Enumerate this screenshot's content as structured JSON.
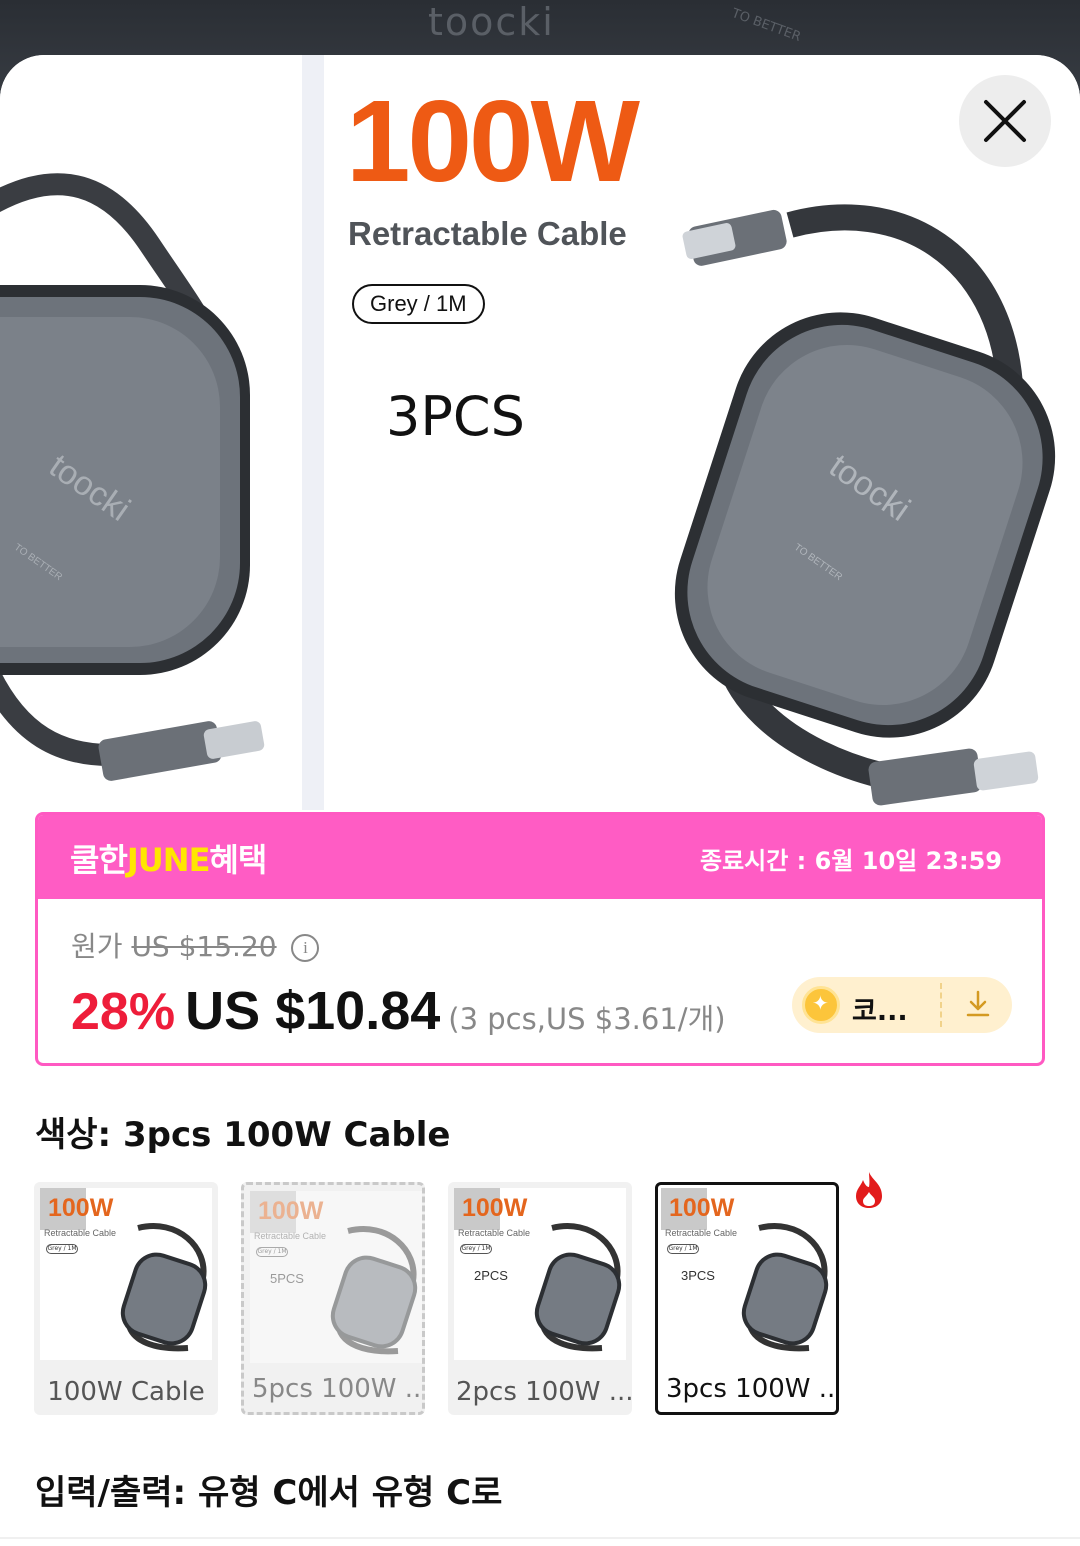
{
  "backdrop": {
    "brand": "toocki",
    "tag": "TO BETTER"
  },
  "hero": {
    "headline": "100W",
    "subline": "Retractable Cable",
    "variant_pill": "Grey / 1M",
    "pcs_label": "3PCS",
    "device_brand": "toocki",
    "device_tag": "TO BETTER"
  },
  "close": {
    "icon": "close-icon"
  },
  "promo": {
    "title_pre": "쿨한",
    "title_highlight": "JUNE",
    "title_post": "혜택",
    "end_time": "종료시간 :  6월 10일 23:59",
    "original_label": "원가",
    "original_price": "US $15.20",
    "discount": "28%",
    "price": "US $10.84",
    "unit_price": "(3 pcs,US $3.61/개)",
    "coupon_label": "코...",
    "colors": {
      "pink": "#ff5cc4",
      "highlight": "#ffe600",
      "discount": "#ee1d3a"
    }
  },
  "color_section": {
    "label": "색상: 3pcs 100W Cable",
    "options": [
      {
        "label": "100W Cable",
        "pcs": "",
        "state": "normal"
      },
      {
        "label": "5pcs 100W ...",
        "pcs": "5PCS",
        "state": "unavailable"
      },
      {
        "label": "2pcs 100W ...",
        "pcs": "2PCS",
        "state": "normal"
      },
      {
        "label": "3pcs 100W ...",
        "pcs": "3PCS",
        "state": "selected",
        "badge": "fire-icon"
      }
    ],
    "thumb_headline": "100W",
    "thumb_sub": "Retractable Cable",
    "thumb_pill": "Grey / 1M"
  },
  "io_section": {
    "label": "입력/출력: 유형 C에서 유형 C로"
  }
}
